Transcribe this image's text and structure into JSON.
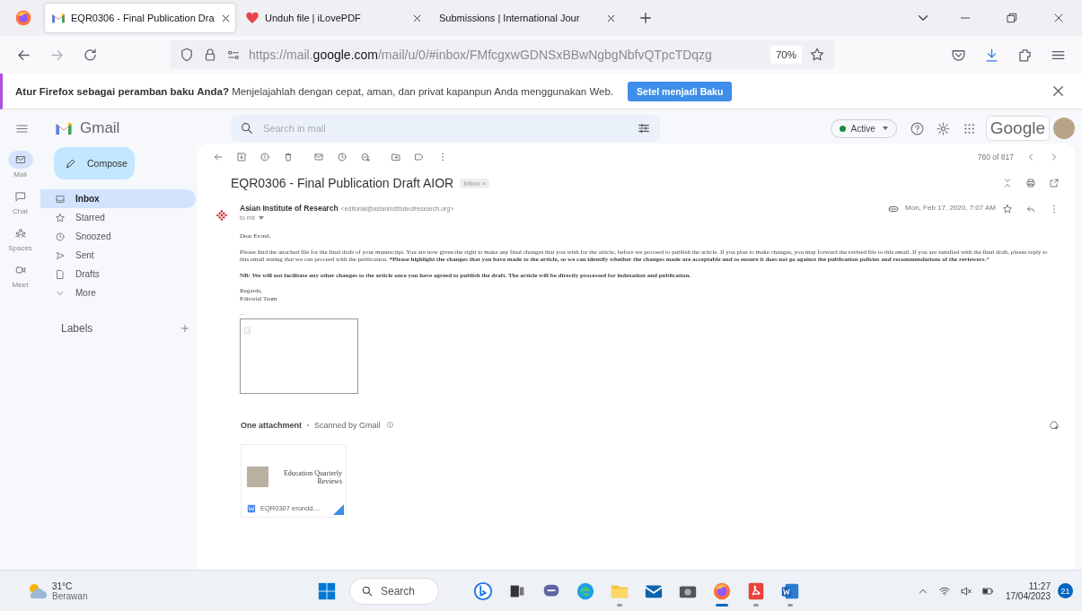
{
  "browser": {
    "tabs": [
      {
        "title": "EQR0306 - Final Publication Dra",
        "kind": "gmail",
        "selected": true
      },
      {
        "title": "Unduh file | iLovePDF",
        "kind": "heart",
        "selected": false
      },
      {
        "title": "Submissions | International Jour",
        "kind": "none",
        "selected": false
      }
    ],
    "url": {
      "prefix": "https://mail.",
      "domain": "google.com",
      "path": "/mail/u/0/#inbox/FMfcgxwGDNSxBBwNgbgNbfvQTpcTDqzg"
    },
    "zoom": "70%"
  },
  "notification": {
    "bold": "Atur Firefox sebagai peramban baku Anda?",
    "text": "Menjelajahlah dengan cepat, aman, dan privat kapanpun Anda menggunakan Web.",
    "button": "Setel menjadi Baku"
  },
  "gmail": {
    "logo": "Gmail",
    "search": {
      "placeholder": "Search in mail"
    },
    "status": "Active",
    "google": "Google",
    "rail": [
      {
        "label": "Mail",
        "kind": "mail",
        "selected": true
      },
      {
        "label": "Chat",
        "kind": "chat",
        "selected": false
      },
      {
        "label": "Spaces",
        "kind": "spaces",
        "selected": false
      },
      {
        "label": "Meet",
        "kind": "meet",
        "selected": false
      }
    ],
    "compose": "Compose",
    "nav": [
      {
        "label": "Inbox",
        "kind": "inbox",
        "selected": true
      },
      {
        "label": "Starred",
        "kind": "star",
        "selected": false
      },
      {
        "label": "Snoozed",
        "kind": "clock",
        "selected": false
      },
      {
        "label": "Sent",
        "kind": "send",
        "selected": false
      },
      {
        "label": "Drafts",
        "kind": "file",
        "selected": false
      },
      {
        "label": "More",
        "kind": "chevron",
        "selected": false
      }
    ],
    "labels_heading": "Labels"
  },
  "message": {
    "counter": "760 of 817",
    "subject": "EQR0306 - Final Publication Draft AIOR",
    "label": "Inbox",
    "label_close": "×",
    "sender": "Asian Institute of Research",
    "email": "<editorial@asianinstituteofresearch.org>",
    "to": "to me",
    "date": "Mon, Feb 17, 2020, 7:07 AM",
    "greeting": "Dear Erond,",
    "paragraphs": [
      "Please find the attached file for the final draft of your manuscript. You are now given the right to make any final changes that you wish for the article, before we proceed to publish the article. If you plan to make changes, you may forward the revised file to this email. If you are satisfied with the final draft, please reply to this email stating that we can proceed with the publication. ***Please highlight the changes that you have made to the article, so we can identify whether the changes made are acceptable and to ensure it does not go against the publication policies and recommendations of the reviewers.***",
      "**NB: We will not facilitate any other changes to the article once you have agreed to publish the draft. The article will be directly processed for indexation and publication.**"
    ],
    "sign_off": "Regards,",
    "signature": "Editorial Team",
    "separator": "--"
  },
  "attachments": {
    "heading": "One attachment",
    "scanned": "Scanned by Gmail",
    "files": [
      {
        "preview_title": "Education Quarterly Reviews",
        "name": "EQR0307 erondd...."
      }
    ]
  },
  "taskbar": {
    "temperature": "31°C",
    "weather": "Berawan",
    "search": "Search",
    "time": "11:27",
    "date": "17/04/2023",
    "badge": "21",
    "apps": [
      {
        "kind": "bing",
        "running": false,
        "selected": false
      },
      {
        "kind": "taskview",
        "running": false,
        "selected": false
      },
      {
        "kind": "chat",
        "running": false,
        "selected": false
      },
      {
        "kind": "edge",
        "running": false,
        "selected": false
      },
      {
        "kind": "folder",
        "running": true,
        "selected": false
      },
      {
        "kind": "mail",
        "running": false,
        "selected": false
      },
      {
        "kind": "camera",
        "running": false,
        "selected": false
      },
      {
        "kind": "firefox",
        "running": true,
        "selected": true
      },
      {
        "kind": "pdf",
        "running": true,
        "selected": false
      },
      {
        "kind": "word",
        "running": true,
        "selected": false
      }
    ]
  }
}
